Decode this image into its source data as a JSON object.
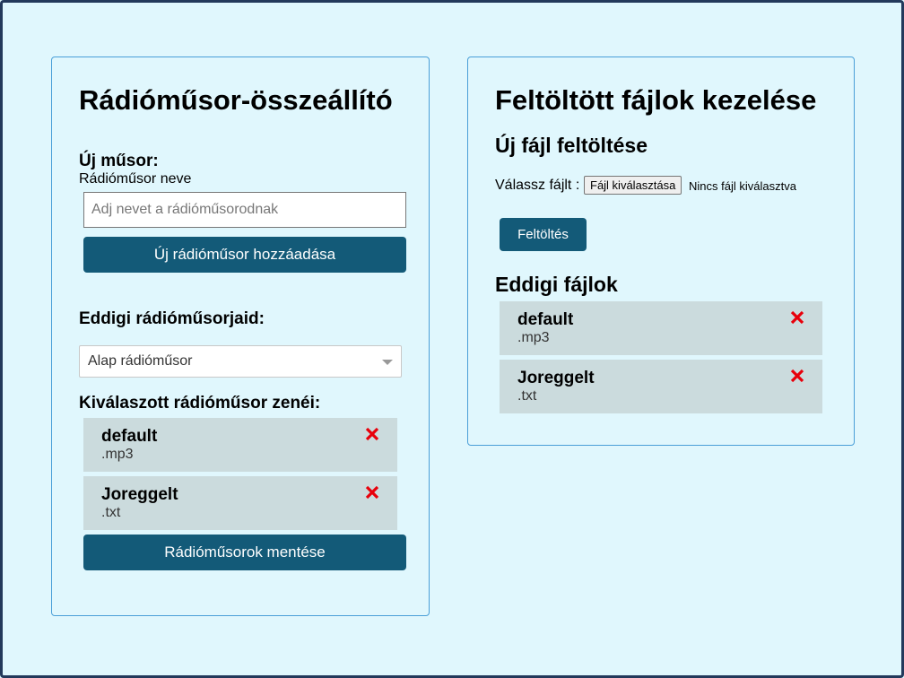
{
  "left": {
    "title": "Rádióműsor-összeállító",
    "new_show_heading": "Új műsor:",
    "show_name_label": "Rádióműsor neve",
    "show_name_placeholder": "Adj nevet a rádióműsorodnak",
    "add_show_button": "Új rádióműsor hozzáadása",
    "existing_shows_heading": "Eddigi rádióműsorjaid:",
    "selected_show": "Alap rádióműsor",
    "selected_songs_heading": "Kiválaszott rádióműsor zenéi:",
    "songs": [
      {
        "name": "default",
        "ext": ".mp3"
      },
      {
        "name": "Joreggelt",
        "ext": ".txt"
      }
    ],
    "save_button": "Rádióműsorok mentése"
  },
  "right": {
    "title": "Feltöltött fájlok kezelése",
    "upload_heading": "Új fájl feltöltése",
    "choose_file_label": "Válassz fájlt :",
    "file_button": "Fájl kiválasztása",
    "no_file_text": "Nincs fájl kiválasztva",
    "upload_button": "Feltöltés",
    "files_heading": "Eddigi fájlok",
    "files": [
      {
        "name": "default",
        "ext": ".mp3"
      },
      {
        "name": "Joreggelt",
        "ext": ".txt"
      }
    ]
  },
  "colors": {
    "background": "#e0f7fd",
    "button": "#135a78",
    "list_item": "#cbdbdd",
    "delete": "#e8000b"
  },
  "icons": {
    "delete": "close-icon"
  }
}
